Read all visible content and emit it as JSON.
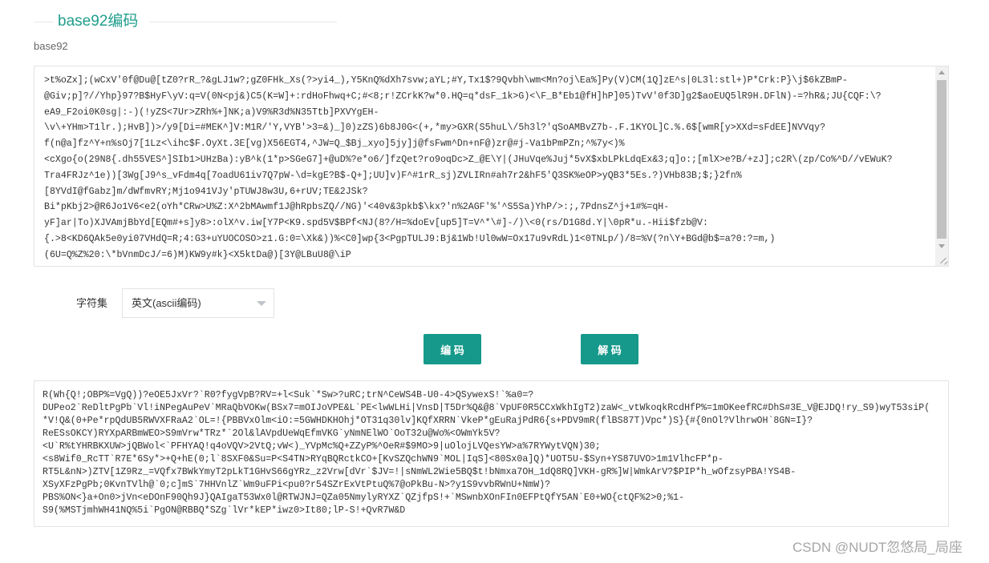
{
  "page": {
    "title": "base92编码",
    "subtitle": "base92"
  },
  "input": {
    "lines": [
      ">t%oZx];(wCxV'0f@Du@[tZ0?rR_?&gLJ1w?;gZ0FHk_Xs(?>yi4_),Y5KnQ%dXh7svw;aYL;#Y,Tx1$?9Qvbh\\wm<Mn?oj\\Ea%]Py(V)CM(1Q]zE^s|0L3l:stl+)P*Crk:P}\\j$6kZBmP-",
      "@Giv;p]?//Yhp}97?B$HyF\\yV:q=V(0N<pj&)C5(K=W]+:rdHoFhwq+C;#<8;r!ZCrkK?w*0.HQ=q*dsF_1k>G)<\\F_B*Eb1@fH]hP]05)TvV'0f3D]g2$aoEUQ5lR9H.DFlN)-=?hR&;JU{CQF:\\?",
      "eA9_F2oi0K0sg|:-)(!yZS<7Ur>ZRh%+]NK;a)V9%R3d%N35Ttb]PXVYgEH-",
      "\\v\\+YHm>T1lr.);HvB])>/y9[Di=#MEK^]V:M1R/'Y,VYB'>3=&)_]0)zZS)6b8J0G<(+,*my>GXR(S5huL\\/5h3l?'qSoAMBvZ7b-.F.1KYOL]C.%.6$[wmR[y>XXd=sFdEE]NVVqy?",
      "f(n@a]fz^Y+n%sOj7[1Lz<\\ihc$F.OyXt.3E[vg)X56EGT4,^JW=Q_$Bj_xyo]5jy]j@fsFwm^Dn+nF@)zr@#j-Va1bPmPZn;^%7y<)%",
      "<cXgo{o(29N8{.dh55VES^]SIb1>UHzBa):yB^k(1*p>SGeG7]+@uD%?e*o6/]fzQet?ro9oqDc>Z_@E\\Y|(JHuVqe%Juj*5vX$xbLPkLdqEx&3;q]o:;[mlX>e?B/+zJ];c2R\\(zp/Co%^D//vEWuK?",
      "Tra4FRJz^1e))[3Wg[J9^s_vFdm4q[7oadU61iv7Q7pW-\\d=kgE?B$-Q+];UU]v)F^#1rR_sj)ZVLIRn#ah7r2&hF5'Q3SK%eOP>yQB3*5Es.?)VHb83B;$;}2fn%",
      "[8YVdI@fGabz]m/dWfmvRY;Mj1o941VJy'pTUWJ8w3U,6+rUV;TE&2JSk?",
      "Bi*pKbj2>@R6Jo1V6<e2(oYh*CRw>U%Z:X^2bMAwmf1J@hRpbsZQ//NG)'<40v&3pkb$\\kx?'n%2AGF'%'^S5Sa)YhP/>:;,7PdnsZ^j+1#%=qH-",
      "yF]ar|To)XJVAmjBbYd[EQm#+s]y8>:olX^v.iw[Y7P<K9.spd5V$BPf<NJ(8?/H=%doEv[up5]T=V^*\\#]-/)\\<0(rs/D1G8d.Y|\\0pR*u.-Hii$fzb@V:",
      "{.>8<KD6QAk5e0yi07VHdQ=R;4:G3+uYUOCOSO>z1.G:0=\\Xk&))%<C0]wp{3<PgpTULJ9:Bj&1Wb!Ul0wW=Ox17u9vRdL)1<0TNLp/)/8=%V(?n\\Y+BGd@b$=a?0:?=m,)",
      "(6U=Q%Z%20:\\*bVnmDcJ/=6)M)KW9y#k}<X5ktDa@)[3Y@LBuU8@\\iP"
    ]
  },
  "charset": {
    "label": "字符集",
    "selected": "英文(ascii编码)"
  },
  "buttons": {
    "encode": "编 码",
    "decode": "解 码"
  },
  "output": {
    "lines": [
      "R(Wh{Q!;OBP%=VgQ))?eOE5JxVr?`R0?fygVpB?RV=+l<Suk`*Sw>?uRC;trN^CeWS4B-U0-4>QSywexS!`%a0=?",
      "DUPeo2`ReDltPgPb`Vl!iNPegAuPeV`MRaQbVOKw(BSx7=mOIJoVPE&L`PE<lwWLHi|VnsD|T5Dr%Q&@8`VpUF0R5CCxWkhIgT2)zaW<_vtWkoqkRcdHfP%=1mOKeefRC#DhS#3E_V@EJDQ!ry_S9)wyT53siP(",
      "*V!Q&(0+Pe*rpQdUB5RWVXFRaA2`OL=!{PBBVxOlm<iO:=5GWHDKHOhj*OT31q30lv]KQfXRRN`VkeP*gEuRajPdR6{s+PDV9mR(flBS87T)Vpc*)S}{#{0nOl?VlhrwOH`8GN=I}?",
      "ReESsOKCY)RYXpARBmWEO>S9mVrw*TRz*`2Ol&lAVpdUeWqEfmVKG`yNmNElWO`OoT32u@Wo%<OWmYk5V?",
      "<U`R%tYHRBKXUW>jQBWol<`PFHYAQ!q4oVQV>2VtQ;vW<)_YVpMc%Q+ZZyP%^OeR#$9MO>9|uOlojLVQesYW>a%7RYWytVQN)30;",
      "<s8Wif0_RcTT`R7E*6Sy*>+Q+hE(0;l`8SXF0&Su=P<S4TN>RYqBQRctkCO+[KvSZQchWN9`MOL|IqS]<80Sx0a]Q)*UOT5U-$Syn+YS87UVO>1m1VlhcFP*p-",
      "RT5L&nN>)ZTV[1Z9Rz_=VQfx7BWkYmyT2pLkT1GHvS66gYRz_z2Vrw[dVr`$JV=!|sNmWL2Wie5BQ$t!bNmxa7OH_1dQ8RQ]VKH-gR%]W|WmkArV?$PIP*h_wOfzsyPBA!YS4B-",
      "XSyXFzPgPb;0KvnTVlh@`0;c]mS`7HHVnlZ`Wm9uFPi<pu0?r54SZrExVtPtuQ%7@oPkBu-N>?y1S9vvbRWnU+NmW)?",
      "PBS%ON<}a+On0>jVn<eDOnF90Qh9J}QAIgaT53Wx0l@RTWJNJ=QZa05NmylyRYXZ`QZjfpS!+`MSwnbXOnFIn0EFPtQfY5AN`E0+WO{ctQF%2>0;%1-",
      "S9(%MSTjmhWH41NQ%5i`PgON@RBBQ*SZg`lVr*kEP*iwz0>It80;lP-S!+QvR7W&D"
    ]
  },
  "watermark": "CSDN @NUDT忽悠局_局座",
  "colors": {
    "accent": "#16998a",
    "title": "#1f9e8d",
    "border": "#e3e3e3"
  },
  "icons": {
    "select_arrow": "chevron-down-icon",
    "scroll_up": "scroll-up-arrow-icon",
    "scroll_down": "scroll-down-arrow-icon",
    "resize": "resize-grip-icon"
  }
}
